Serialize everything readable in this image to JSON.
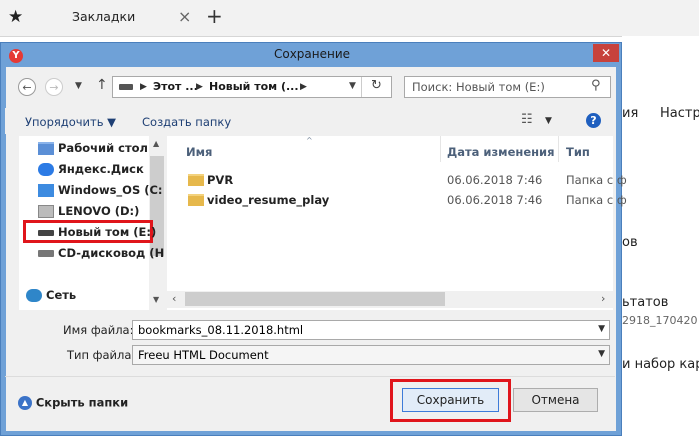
{
  "browser": {
    "tab_star_icon": "★",
    "tab_title": "Закладки",
    "tab_close": "×",
    "tab_new": "+",
    "bg_texts": [
      "ия",
      "Настро",
      "ов",
      "ьтатов",
      "2918_170420",
      "и набор кар"
    ]
  },
  "dialog": {
    "title": "Сохранение",
    "close_glyph": "✕",
    "address": {
      "crumbs": [
        "Этот ...",
        "Новый том (..."
      ],
      "search_placeholder": "Поиск: Новый том (E:)"
    },
    "toolbar": {
      "organize_label": "Упорядочить ▼",
      "new_folder_label": "Создать папку"
    },
    "nav_items": [
      {
        "label": "Рабочий стол",
        "icon": "desktop-folder-icon"
      },
      {
        "label": "Яндекс.Диск",
        "icon": "yandex-disk-icon"
      },
      {
        "label": "Windows_OS (C:",
        "icon": "windows-drive-icon"
      },
      {
        "label": "LENOVO (D:)",
        "icon": "lenovo-drive-icon"
      },
      {
        "label": "Новый том (E:)",
        "icon": "drive-icon"
      },
      {
        "label": "CD-дисковод (H",
        "icon": "cd-drive-icon"
      },
      {
        "label": "Сеть",
        "icon": "network-icon"
      }
    ],
    "columns": {
      "name": "Имя",
      "date": "Дата изменения",
      "type": "Тип"
    },
    "files": [
      {
        "name": "PVR",
        "date": "06.06.2018 7:46",
        "type": "Папка с ф"
      },
      {
        "name": "video_resume_play",
        "date": "06.06.2018 7:46",
        "type": "Папка с ф"
      }
    ],
    "filename_label": "Имя файла:",
    "filename_value": "bookmarks_08.11.2018.html",
    "filetype_label": "Тип файла:",
    "filetype_value": "Freeu HTML Document",
    "hide_folders_label": "Скрыть папки",
    "save_label": "Сохранить",
    "cancel_label": "Отмена"
  },
  "colors": {
    "titlebar": "#6fa1d7",
    "close": "#c7423c",
    "highlight": "#e0151b"
  }
}
